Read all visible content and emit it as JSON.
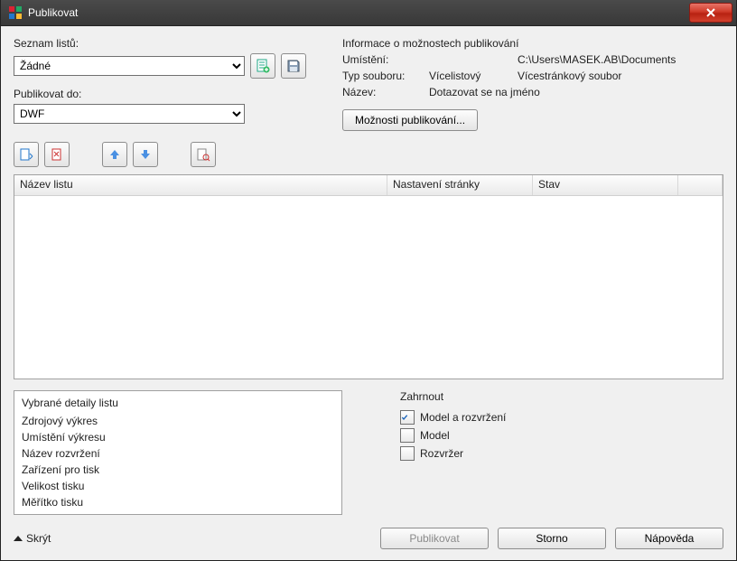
{
  "window": {
    "title": "Publikovat"
  },
  "left": {
    "list_label": "Seznam listů:",
    "list_value": "Žádné",
    "publish_to_label": "Publikovat do:",
    "publish_to_value": "DWF"
  },
  "info": {
    "heading": "Informace o možnostech publikování",
    "location_key": "Umístění:",
    "location_val": "C:\\Users\\MASEK.AB\\Documents",
    "filetype_key": "Typ souboru:",
    "filetype_val1": "Vícelistový",
    "filetype_val2": "Vícestránkový soubor",
    "name_key": "Název:",
    "name_val": "Dotazovat se na jméno",
    "options_btn": "Možnosti publikování..."
  },
  "grid": {
    "col1": "Název listu",
    "col2": "Nastavení stránky",
    "col3": "Stav"
  },
  "details": {
    "title": "Vybrané detaily listu",
    "row1": "Zdrojový výkres",
    "row2": "Umístění výkresu",
    "row3": "Název rozvržení",
    "row4": "Zařízení pro tisk",
    "row5": "Velikost tisku",
    "row6": "Měřítko tisku"
  },
  "include": {
    "heading": "Zahrnout",
    "opt1": "Model a rozvržení",
    "opt2": "Model",
    "opt3": "Rozvržer"
  },
  "footer": {
    "hide": "Skrýt",
    "publish": "Publikovat",
    "cancel": "Storno",
    "help": "Nápověda"
  }
}
